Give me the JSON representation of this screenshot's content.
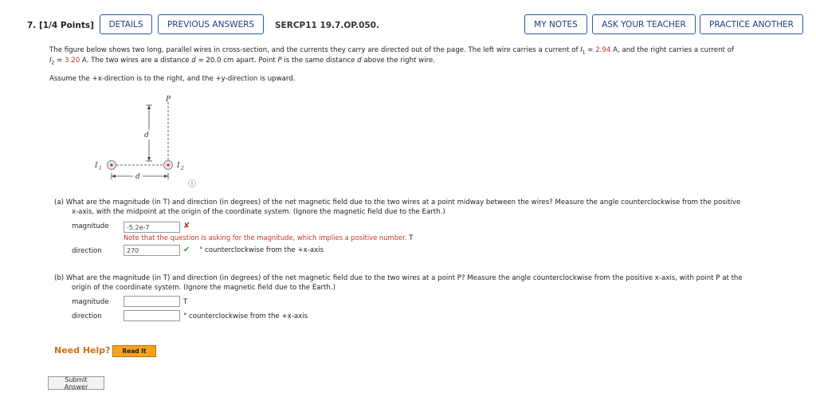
{
  "header": {
    "question_label": "7.  [1/4 Points]",
    "details_label": "DETAILS",
    "previous_answers_label": "PREVIOUS ANSWERS",
    "code": "SERCP11 19.7.OP.050.",
    "my_notes_label": "MY NOTES",
    "ask_teacher_label": "ASK YOUR TEACHER",
    "practice_another_label": "PRACTICE ANOTHER"
  },
  "problem": {
    "line1_pre": "The figure below shows two long, parallel wires in cross-section, and the currents they carry are directed out of the page. The left wire carries a current of ",
    "I1_sym": "I",
    "I1_sub": "1",
    "eq": " = ",
    "I1_value": "2.94",
    "line1_mid": " A, and the right carries a current of",
    "I2_sym": "I",
    "I2_sub": "2",
    "I2_value": "3.20",
    "line2_a": " A. The two wires are a distance ",
    "d_sym": "d",
    "line2_b": " = 20.0 cm apart. Point ",
    "P_sym": "P",
    "line2_c": " is the same distance ",
    "line2_d": " above the right wire.",
    "assume": "Assume the +x-direction is to the right, and the +y-direction is upward."
  },
  "figure": {
    "label_P": "P",
    "label_d_vertical": "d",
    "label_d_horizontal": "d",
    "label_I1": "I",
    "label_I1_sub": "1",
    "label_I2": "I",
    "label_I2_sub": "2",
    "info_icon": "ⓘ"
  },
  "part_a": {
    "text_line1": "(a)  What are the magnitude (in T) and direction (in degrees) of the net magnetic field due to the two wires at a point midway between the wires? Measure the angle counterclockwise from the positive",
    "text_line2": "x-axis, with the midpoint at the origin of the coordinate system. (Ignore the magnetic field due to the Earth.)",
    "magnitude_label": "magnitude",
    "magnitude_value": "-5.2e-7",
    "magnitude_status_icon": "✘",
    "note": "Note that the question is asking for the magnitude, which implies a positive number.",
    "magnitude_unit": "T",
    "direction_label": "direction",
    "direction_value": "270",
    "direction_status_icon": "✔",
    "direction_unit": "° counterclockwise from the +x-axis"
  },
  "part_b": {
    "text_line1": "(b)  What are the magnitude (in T) and direction (in degrees) of the net magnetic field due to the two wires at a point P? Measure the angle counterclockwise from the positive x-axis, with point P at the",
    "text_line2": "origin of the coordinate system. (Ignore the magnetic field due to the Earth.)",
    "magnitude_label": "magnitude",
    "magnitude_value": "",
    "magnitude_unit": "T",
    "direction_label": "direction",
    "direction_value": "",
    "direction_unit": "° counterclockwise from the +x-axis"
  },
  "help": {
    "label": "Need Help?",
    "read_it_label": "Read It"
  },
  "submit_label": "Submit Answer",
  "colors": {
    "accent": "#2c5aa0",
    "error": "#c0392b",
    "success": "#2e9e44",
    "help": "#c9731a",
    "read_it": "#f7a31a"
  }
}
